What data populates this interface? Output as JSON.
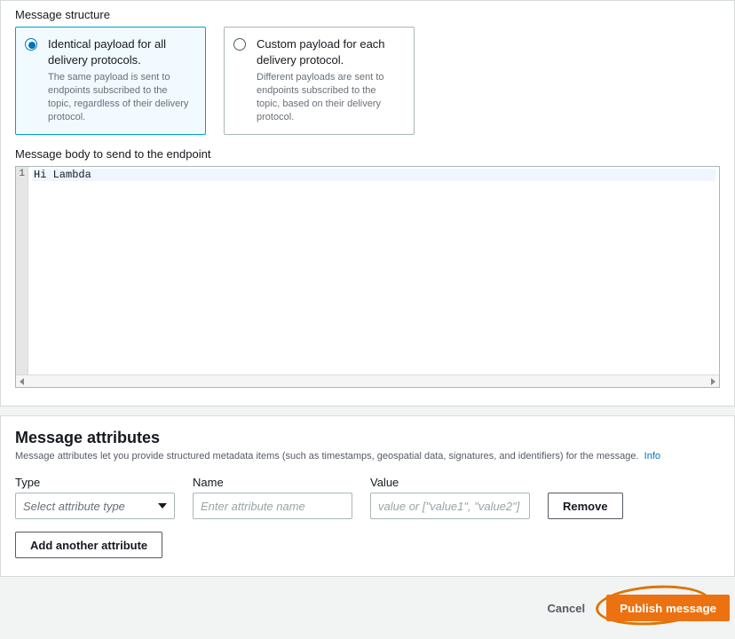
{
  "structure": {
    "label": "Message structure",
    "opt1": {
      "title": "Identical payload for all delivery protocols.",
      "desc": "The same payload is sent to endpoints subscribed to the topic, regardless of their delivery protocol."
    },
    "opt2": {
      "title": "Custom payload for each delivery protocol.",
      "desc": "Different payloads are sent to endpoints subscribed to the topic, based on their delivery protocol."
    }
  },
  "body": {
    "label": "Message body to send to the endpoint",
    "line1_no": "1",
    "content": "Hi Lambda"
  },
  "attributes": {
    "title": "Message attributes",
    "desc": "Message attributes let you provide structured metadata items (such as timestamps, geospatial data, signatures, and identifiers) for the message.",
    "info": "Info",
    "type_label": "Type",
    "type_placeholder": "Select attribute type",
    "name_label": "Name",
    "name_placeholder": "Enter attribute name",
    "value_label": "Value",
    "value_placeholder": "value or [\"value1\", \"value2\"]",
    "remove": "Remove",
    "add": "Add another attribute"
  },
  "footer": {
    "cancel": "Cancel",
    "publish": "Publish message"
  }
}
